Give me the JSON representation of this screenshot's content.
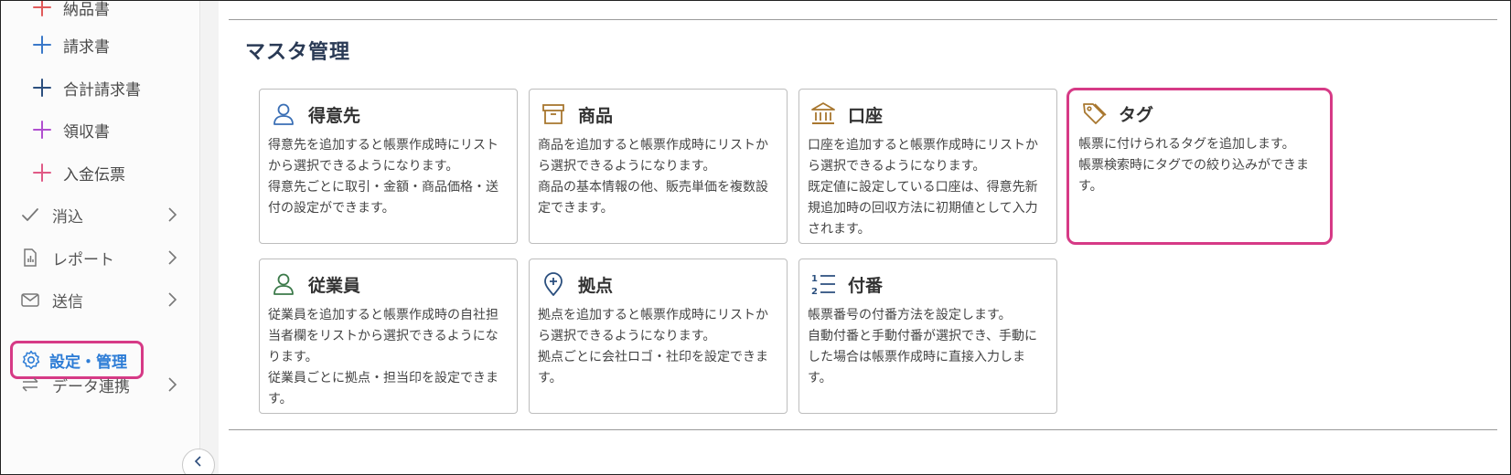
{
  "sidebar": {
    "sub_items": [
      {
        "label": "納品書",
        "color": "#e15b5b",
        "icon": "plus-icon"
      },
      {
        "label": "請求書",
        "color": "#3a78c9",
        "icon": "plus-icon"
      },
      {
        "label": "合計請求書",
        "color": "#2b4f7e",
        "icon": "plus-icon"
      },
      {
        "label": "領収書",
        "color": "#b04fcf",
        "icon": "plus-icon"
      },
      {
        "label": "入金伝票",
        "color": "#e05a86",
        "icon": "plus-icon"
      }
    ],
    "main_items": [
      {
        "label": "消込",
        "icon": "check-icon"
      },
      {
        "label": "レポート",
        "icon": "report-icon"
      },
      {
        "label": "送信",
        "icon": "mail-icon"
      }
    ],
    "active_item": {
      "label": "設定・管理",
      "icon": "gear-icon"
    },
    "last_item": {
      "label": "データ連携",
      "icon": "sync-arrows-icon"
    },
    "collapse_icon": "chevron-left-icon"
  },
  "main": {
    "section_title": "マスタ管理",
    "cards": [
      {
        "title": "得意先",
        "icon": "person-icon",
        "description": "得意先を追加すると帳票作成時にリスト\nから選択できるようになります。\n得意先ごとに取引・金額・商品価格・送\n付の設定ができます。"
      },
      {
        "title": "商品",
        "icon": "box-icon",
        "description": "商品を追加すると帳票作成時にリストか\nら選択できるようになります。\n商品の基本情報の他、販売単価を複数設\n定できます。"
      },
      {
        "title": "口座",
        "icon": "bank-icon",
        "description": "口座を追加すると帳票作成時にリストか\nら選択できるようになります。\n既定値に設定している口座は、得意先新\n規追加時の回収方法に初期値として入力\nされます。"
      },
      {
        "title": "タグ",
        "icon": "tag-icon",
        "description": "帳票に付けられるタグを追加します。\n帳票検索時にタグでの絞り込みができま\nす。"
      },
      {
        "title": "従業員",
        "icon": "employee-icon",
        "description": "従業員を追加すると帳票作成時の自社担\n当者欄をリストから選択できるようにな\nります。\n従業員ごとに拠点・担当印を設定できま\nす。"
      },
      {
        "title": "拠点",
        "icon": "location-pin-icon",
        "description": "拠点を追加すると帳票作成時にリストか\nら選択できるようになります。\n拠点ごとに会社ロゴ・社印を設定できま\nす。"
      },
      {
        "title": "付番",
        "icon": "numbered-list-icon",
        "description": "帳票番号の付番方法を設定します。\n自動付番と手動付番が選択でき、手動に\nした場合は帳票作成時に直接入力しま\nす。"
      }
    ]
  },
  "colors": {
    "highlight": "#d63a86",
    "active_text": "#2e7dd6",
    "icon_blue": "#3a6fb5",
    "icon_gold": "#a8772f",
    "icon_green": "#3c7a4a"
  }
}
